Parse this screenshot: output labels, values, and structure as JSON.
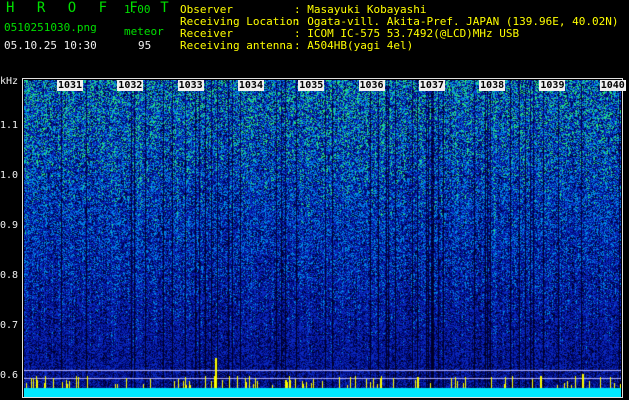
{
  "header": {
    "brand": "H R O F F T",
    "version": "1.00",
    "filename": "0510251030.png",
    "datetime": "05.10.25 10:30",
    "meteor_label": "meteor",
    "meteor_count": "95"
  },
  "info": [
    {
      "label": "Observer",
      "value": ": Masayuki Kobayashi"
    },
    {
      "label": "Receiving Location",
      "value": ": Ogata-vill. Akita-Pref. JAPAN (139.96E, 40.02N)"
    },
    {
      "label": "Receiver",
      "value": ": ICOM IC-575 53.7492(@LCD)MHz USB"
    },
    {
      "label": "Receiving antenna",
      "value": ": A504HB(yagi 4el)"
    }
  ],
  "axis": {
    "unit": "kHz",
    "ticks": [
      "1.1",
      "1.0",
      "0.9",
      "0.8",
      "0.7",
      "0.6"
    ]
  },
  "time_marks": [
    "1031",
    "1032",
    "1033",
    "1034",
    "1035",
    "1036",
    "1037",
    "1038",
    "1039",
    "1040"
  ]
}
